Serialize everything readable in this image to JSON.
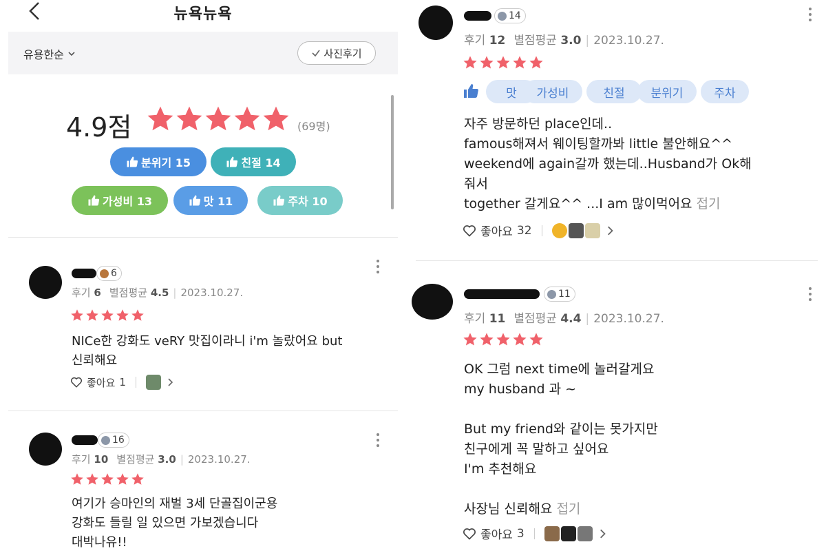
{
  "header": {
    "title": "뉴욕뉴욕"
  },
  "sort": {
    "selected": "유용한순",
    "photo_filter": "사진후기"
  },
  "summary": {
    "score": "4.9",
    "score_unit": "점",
    "count": "(69명)",
    "chips": [
      {
        "label": "분위기 15",
        "color": "#4a8fe0"
      },
      {
        "label": "친절 14",
        "color": "#3fb1b8"
      },
      {
        "label": "가성비 13",
        "color": "#7cc25a"
      },
      {
        "label": "맛 11",
        "color": "#5a9de6"
      },
      {
        "label": "주차 10",
        "color": "#79ccc9"
      }
    ]
  },
  "colors": {
    "star": "#f0616a",
    "thumb": "#4a7fd0"
  },
  "left_reviews": [
    {
      "level": "6",
      "review_count": "6",
      "rating": "4.5",
      "date": "2023.10.27.",
      "body": "NICe한 강화도 veRY 맛집이라니 i'm 놀랐어요 but\n신뢰해요",
      "likes": "1"
    },
    {
      "level": "16",
      "review_count": "10",
      "rating": "3.0",
      "date": "2023.10.27.",
      "body": "여기가 승마인의 재벌 3세 단골집이군용\n강화도 들릴 일 있으면 가보겠습니다\n대박나유!!"
    }
  ],
  "right_reviews": [
    {
      "level": "14",
      "review_count": "12",
      "rating": "3.0",
      "date": "2023.10.27.",
      "tags": [
        "맛",
        "가성비",
        "친절",
        "분위기",
        "주차"
      ],
      "body": "자주 방문하던 place인데..\nfamous해져서 웨이팅할까봐 little 불안해요^^\nweekend에 again갈까 했는데..Husband가 Ok해\n줘서\ntogether 갈게요^^ ...I am 많이먹어요",
      "likes": "32"
    },
    {
      "level": "11",
      "review_count": "11",
      "rating": "4.4",
      "date": "2023.10.27.",
      "body": "OK 그럼 next time에 놀러갈게요\nmy husband 과 ~\n\nBut my friend와 같이는 못가지만\n친구에게 꼭 말하고 싶어요\nI'm 추천해요\n\n사장님 신뢰해요",
      "likes": "3"
    }
  ],
  "labels": {
    "review_prefix": "후기",
    "rating_prefix": "별점평균",
    "like_prefix": "좋아요",
    "fold": "접기"
  }
}
